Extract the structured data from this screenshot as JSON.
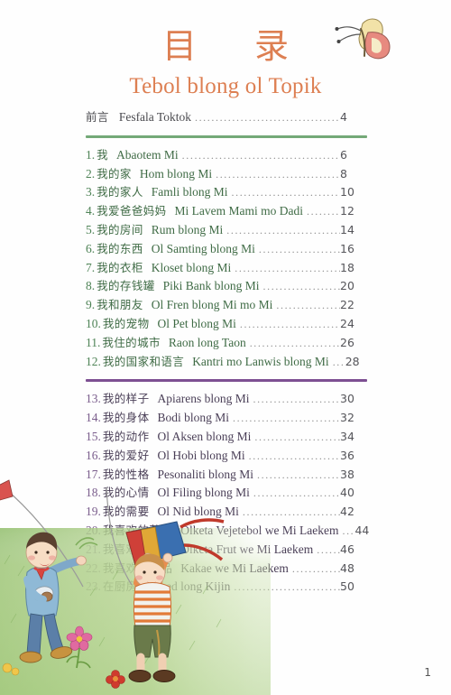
{
  "header": {
    "cjk_title": "目 录",
    "latin_title": "Tebol blong ol Topik"
  },
  "preface": {
    "number": "",
    "zh": "前言",
    "latin": "Fesfala Toktok",
    "page": "4",
    "dots": "............................................................................"
  },
  "sections": [
    {
      "id": "section-green",
      "accent": "#74a978",
      "entries": [
        {
          "number": "1.",
          "zh": "我",
          "latin": "Abaotem Mi",
          "page": "6"
        },
        {
          "number": "2.",
          "zh": "我的家",
          "latin": "Hom blong Mi",
          "page": "8"
        },
        {
          "number": "3.",
          "zh": "我的家人",
          "latin": "Famli blong Mi",
          "page": "10"
        },
        {
          "number": "4.",
          "zh": "我爱爸爸妈妈",
          "latin": "Mi Lavem Mami mo Dadi",
          "page": "12"
        },
        {
          "number": "5.",
          "zh": "我的房间",
          "latin": "Rum blong Mi",
          "page": "14"
        },
        {
          "number": "6.",
          "zh": "我的东西",
          "latin": "Ol Samting blong Mi",
          "page": "16"
        },
        {
          "number": "7.",
          "zh": "我的衣柜",
          "latin": "Kloset blong Mi",
          "page": "18"
        },
        {
          "number": "8.",
          "zh": "我的存钱罐",
          "latin": "Piki Bank blong Mi",
          "page": "20"
        },
        {
          "number": "9.",
          "zh": "我和朋友",
          "latin": "Ol Fren blong Mi mo Mi",
          "page": "22"
        },
        {
          "number": "10.",
          "zh": "我的宠物",
          "latin": "Ol Pet blong Mi",
          "page": "24"
        },
        {
          "number": "11.",
          "zh": "我住的城市",
          "latin": "Raon long Taon",
          "page": "26"
        },
        {
          "number": "12.",
          "zh": "我的国家和语言",
          "latin": "Kantri mo Lanwis blong Mi",
          "page": "28"
        }
      ]
    },
    {
      "id": "section-purple",
      "accent": "#7d4f92",
      "entries": [
        {
          "number": "13.",
          "zh": "我的样子",
          "latin": "Apiarens blong Mi",
          "page": "30"
        },
        {
          "number": "14.",
          "zh": "我的身体",
          "latin": "Bodi blong Mi",
          "page": "32"
        },
        {
          "number": "15.",
          "zh": "我的动作",
          "latin": "Ol Aksen blong Mi",
          "page": "34"
        },
        {
          "number": "16.",
          "zh": "我的爱好",
          "latin": "Ol Hobi blong Mi",
          "page": "36"
        },
        {
          "number": "17.",
          "zh": "我的性格",
          "latin": "Pesonaliti blong Mi",
          "page": "38"
        },
        {
          "number": "18.",
          "zh": "我的心情",
          "latin": "Ol Filing blong Mi",
          "page": "40"
        },
        {
          "number": "19.",
          "zh": "我的需要",
          "latin": "Ol Nid blong Mi",
          "page": "42"
        },
        {
          "number": "20.",
          "zh": "我喜欢的蔬菜",
          "latin": "Olketa Vejetebol we Mi Laekem",
          "page": "44"
        },
        {
          "number": "21.",
          "zh": "我喜欢的水果",
          "latin": "Olketa Frut we Mi Laekem",
          "page": "46"
        },
        {
          "number": "22.",
          "zh": "我喜欢的食品",
          "latin": "Kakae we Mi Laekem",
          "page": "48"
        },
        {
          "number": "23.",
          "zh": "在厨房",
          "latin": "Insaed long Kijin",
          "page": "50"
        }
      ]
    }
  ],
  "footer": {
    "page_number": "1"
  },
  "colors": {
    "title": "#dd7f52",
    "green_accent": "#74a978",
    "purple_accent": "#7d4f92",
    "dot_leader": "#8b8b8b"
  },
  "illustration": {
    "scene": "two boys flying a kite on grass",
    "butterfly": "butterfly-illustration"
  }
}
